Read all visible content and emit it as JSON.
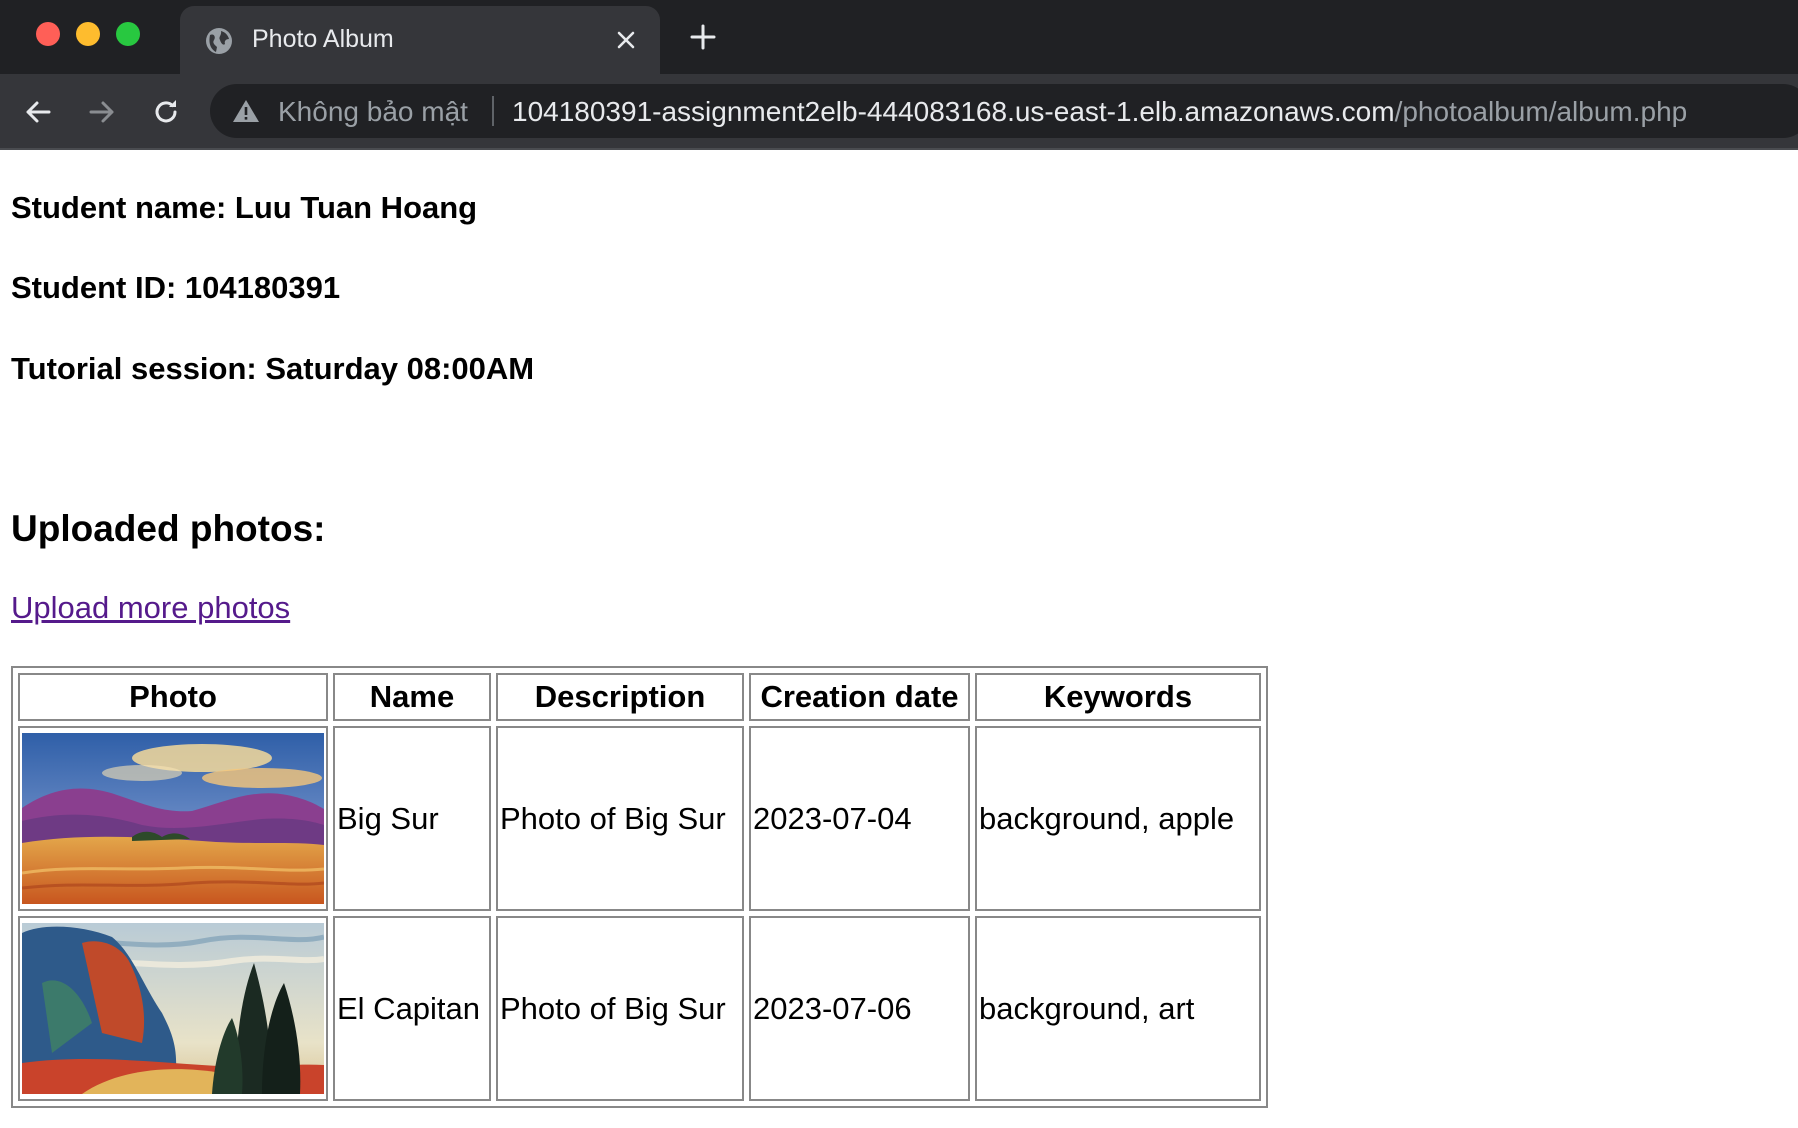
{
  "browser": {
    "tab_title": "Photo Album",
    "security_label": "Không bảo mật",
    "url_host": "104180391-assignment2elb-444083168.us-east-1.elb.amazonaws.com",
    "url_path": "/photoalbum/album.php"
  },
  "page": {
    "student_name": "Student name: Luu Tuan Hoang",
    "student_id": "Student ID: 104180391",
    "tutorial_session": "Tutorial session: Saturday 08:00AM",
    "uploaded_heading": "Uploaded photos:",
    "upload_link": "Upload more photos"
  },
  "table": {
    "headers": [
      "Photo",
      "Name",
      "Description",
      "Creation date",
      "Keywords"
    ],
    "rows": [
      {
        "photo_icon": "landscape-painting-golden-field-image",
        "name": "Big Sur",
        "description": "Photo of Big Sur",
        "creation_date": "2023-07-04",
        "keywords": "background, apple"
      },
      {
        "photo_icon": "landscape-painting-cliffs-cypress-image",
        "name": "El Capitan",
        "description": "Photo of Big Sur",
        "creation_date": "2023-07-06",
        "keywords": "background, art"
      }
    ]
  },
  "colors": {
    "chrome_dark": "#202124",
    "chrome_toolbar": "#35363a",
    "link_visited": "#551a8b"
  }
}
